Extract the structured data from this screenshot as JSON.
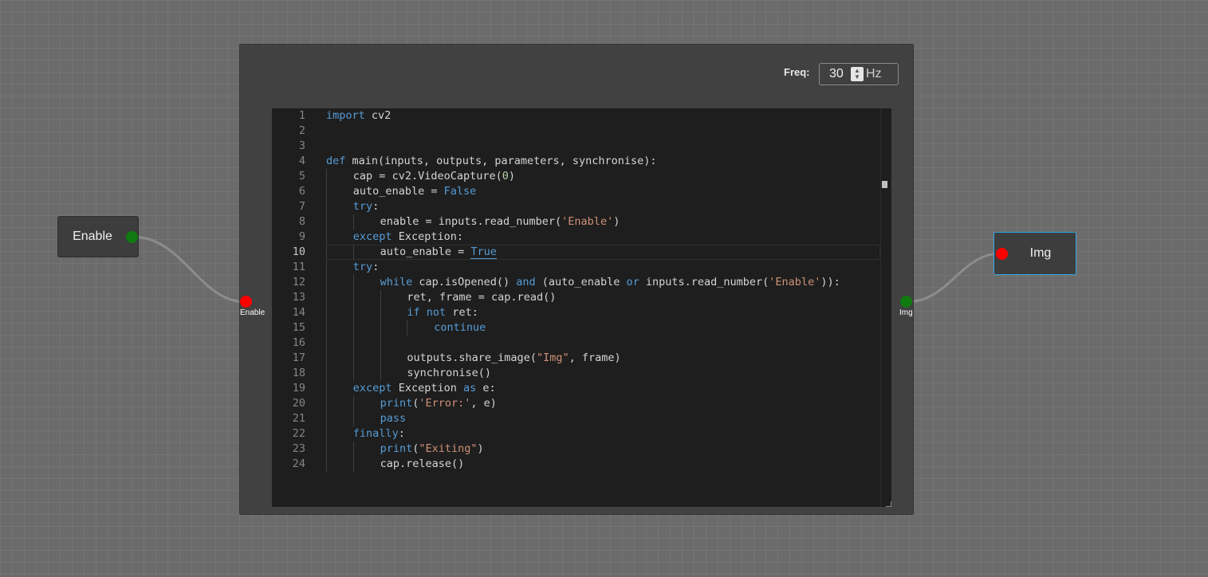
{
  "colors": {
    "canvas": "#6b6b6b",
    "node": "#3d3d3d",
    "selected_border": "#2aa4e0",
    "port_output": "#0f7a0f",
    "port_input": "#ff0000",
    "keyword": "#569cd6",
    "string": "#ce9178",
    "number": "#b5cea8"
  },
  "nodes": {
    "enable": {
      "label": "Enable",
      "port": "green-output-port"
    },
    "img": {
      "label": "Img",
      "port": "red-input-port"
    }
  },
  "code_node": {
    "freq_label": "Freq:",
    "freq_value": "30",
    "freq_unit": "Hz",
    "input_port_label": "Enable",
    "output_port_label": "Img",
    "current_line": 10,
    "lines": [
      {
        "n": "1",
        "indent": 0,
        "tokens": [
          [
            "kw",
            "import"
          ],
          [
            "t",
            " cv2"
          ]
        ]
      },
      {
        "n": "2",
        "indent": 0,
        "tokens": []
      },
      {
        "n": "3",
        "indent": 0,
        "tokens": []
      },
      {
        "n": "4",
        "indent": 0,
        "tokens": [
          [
            "kw",
            "def"
          ],
          [
            "t",
            " main(inputs, outputs, parameters, synchronise):"
          ]
        ]
      },
      {
        "n": "5",
        "indent": 1,
        "tokens": [
          [
            "t",
            "cap = cv2.VideoCapture("
          ],
          [
            "num",
            "0"
          ],
          [
            "t",
            ")"
          ]
        ]
      },
      {
        "n": "6",
        "indent": 1,
        "tokens": [
          [
            "t",
            "auto_enable = "
          ],
          [
            "kw",
            "False"
          ]
        ]
      },
      {
        "n": "7",
        "indent": 1,
        "tokens": [
          [
            "kw",
            "try"
          ],
          [
            "t",
            ":"
          ]
        ]
      },
      {
        "n": "8",
        "indent": 2,
        "tokens": [
          [
            "t",
            "enable = inputs.read_number("
          ],
          [
            "str",
            "'Enable'"
          ],
          [
            "t",
            ")"
          ]
        ]
      },
      {
        "n": "9",
        "indent": 1,
        "tokens": [
          [
            "kw",
            "except"
          ],
          [
            "t",
            " Exception:"
          ]
        ]
      },
      {
        "n": "10",
        "indent": 2,
        "tokens": [
          [
            "t",
            "auto_enable = "
          ],
          [
            "kwsel",
            "True"
          ]
        ]
      },
      {
        "n": "11",
        "indent": 1,
        "tokens": [
          [
            "kw",
            "try"
          ],
          [
            "t",
            ":"
          ]
        ]
      },
      {
        "n": "12",
        "indent": 2,
        "tokens": [
          [
            "kw",
            "while"
          ],
          [
            "t",
            " cap.isOpened() "
          ],
          [
            "kw",
            "and"
          ],
          [
            "t",
            " (auto_enable "
          ],
          [
            "kw",
            "or"
          ],
          [
            "t",
            " inputs.read_number("
          ],
          [
            "str",
            "'Enable'"
          ],
          [
            "t",
            "))"
          ],
          [
            "t",
            ":"
          ]
        ]
      },
      {
        "n": "13",
        "indent": 3,
        "tokens": [
          [
            "t",
            "ret, frame = cap.read()"
          ]
        ]
      },
      {
        "n": "14",
        "indent": 3,
        "tokens": [
          [
            "kw",
            "if"
          ],
          [
            "t",
            " "
          ],
          [
            "kw",
            "not"
          ],
          [
            "t",
            " ret:"
          ]
        ]
      },
      {
        "n": "15",
        "indent": 4,
        "tokens": [
          [
            "kw",
            "continue"
          ]
        ]
      },
      {
        "n": "16",
        "indent": 0,
        "tokens": []
      },
      {
        "n": "17",
        "indent": 3,
        "tokens": [
          [
            "t",
            "outputs.share_image("
          ],
          [
            "str",
            "\"Img\""
          ],
          [
            "t",
            ", frame)"
          ]
        ]
      },
      {
        "n": "18",
        "indent": 3,
        "tokens": [
          [
            "t",
            "synchronise()"
          ]
        ]
      },
      {
        "n": "19",
        "indent": 1,
        "tokens": [
          [
            "kw",
            "except"
          ],
          [
            "t",
            " Exception "
          ],
          [
            "kw",
            "as"
          ],
          [
            "t",
            " e:"
          ]
        ]
      },
      {
        "n": "20",
        "indent": 2,
        "tokens": [
          [
            "kw",
            "print"
          ],
          [
            "t",
            "("
          ],
          [
            "str",
            "'Error:'"
          ],
          [
            "t",
            ", e)"
          ]
        ]
      },
      {
        "n": "21",
        "indent": 2,
        "tokens": [
          [
            "kw",
            "pass"
          ]
        ]
      },
      {
        "n": "22",
        "indent": 1,
        "tokens": [
          [
            "kw",
            "finally"
          ],
          [
            "t",
            ":"
          ]
        ]
      },
      {
        "n": "23",
        "indent": 2,
        "tokens": [
          [
            "kw",
            "print"
          ],
          [
            "t",
            "("
          ],
          [
            "str",
            "\"Exiting\""
          ],
          [
            "t",
            ")"
          ]
        ]
      },
      {
        "n": "24",
        "indent": 2,
        "tokens": [
          [
            "t",
            "cap.release()"
          ]
        ]
      }
    ]
  }
}
